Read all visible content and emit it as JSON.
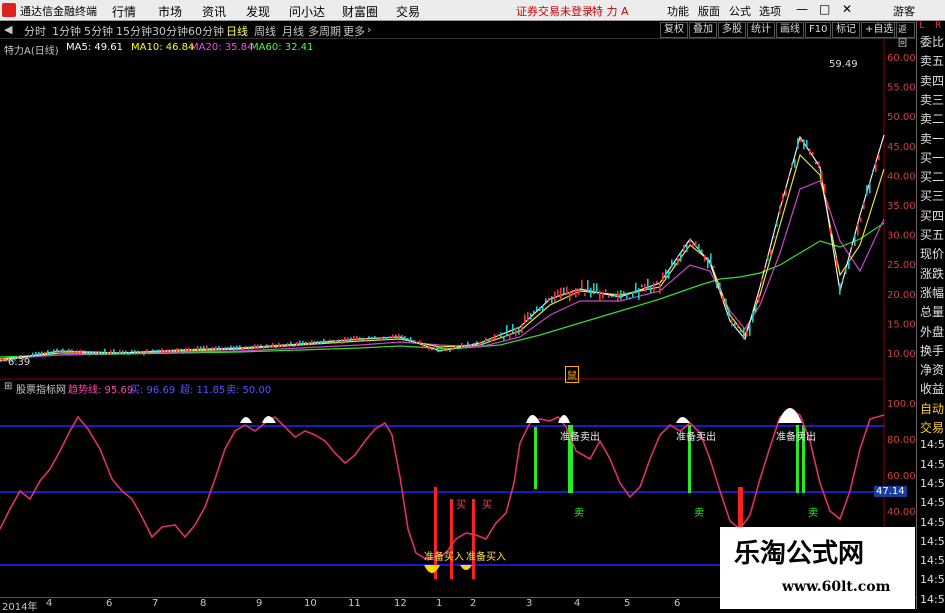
{
  "topbar": {
    "app_title": "通达信金融终端",
    "menu": [
      "行情",
      "市场",
      "资讯",
      "发现",
      "问小达",
      "财富圈",
      "交易"
    ],
    "notice": "证券交易未登录",
    "stock_name": "特 力 A",
    "right_menu": [
      "功能",
      "版面",
      "公式",
      "选项"
    ],
    "guest": "游客"
  },
  "periods": {
    "items": [
      "分时",
      "1分钟",
      "5分钟",
      "15分钟",
      "30分钟",
      "60分钟",
      "日线",
      "周线",
      "月线",
      "多周期",
      "更多"
    ],
    "active_index": 6
  },
  "tools": [
    "复权",
    "叠加",
    "多股",
    "统计",
    "画线",
    "F10",
    "标记",
    "+自选",
    "返回"
  ],
  "main_chart": {
    "title": "特力A(日线)",
    "ma": [
      {
        "label": "MA5: 49.61",
        "color": "#ffffff"
      },
      {
        "label": "MA10: 46.84",
        "color": "#ffff00"
      },
      {
        "label": "MA20: 35.84",
        "color": "#ff44ff"
      },
      {
        "label": "MA60: 32.41",
        "color": "#44ff44"
      }
    ],
    "y_labels": [
      "60.00",
      "55.00",
      "50.00",
      "45.00",
      "40.00",
      "35.00",
      "30.00",
      "25.00",
      "20.00",
      "15.00",
      "10.00"
    ],
    "high_label": "59.49",
    "low_label": "6.39",
    "marker": "鼠"
  },
  "indicator": {
    "name": "股票指标网",
    "legend": [
      {
        "label": "趋势线: 95.69",
        "color": "#ff44aa"
      },
      {
        "label": "买: 96.69",
        "color": "#5555ff"
      },
      {
        "label": "超: 11.85",
        "color": "#5555ff"
      },
      {
        "label": "卖: 50.00",
        "color": "#5555ff"
      }
    ],
    "y_labels": [
      "100.00",
      "80.00",
      "60.00",
      "40.00"
    ],
    "level_label": "47.14",
    "sell_labels": [
      "准备卖出",
      "准备卖出",
      "准备卖出"
    ],
    "buy_labels": [
      "准备买入",
      "准备买入"
    ],
    "buy_marks": [
      "买",
      "买"
    ],
    "sell_marks": [
      "卖",
      "卖",
      "卖"
    ]
  },
  "sidepanel": [
    "委比",
    "卖五",
    "卖四",
    "卖三",
    "卖二",
    "卖一",
    "买一",
    "买二",
    "买三",
    "买四",
    "买五",
    "现价",
    "涨跌",
    "涨幅",
    "总量",
    "外盘",
    "换手",
    "净资",
    "收益",
    "自动",
    "交易",
    "14:5",
    "14:5",
    "14:5",
    "14:5",
    "14:5",
    "14:5",
    "14:5",
    "14:5",
    "14:5"
  ],
  "x_axis": [
    "2014年",
    "4",
    "6",
    "7",
    "8",
    "9",
    "10",
    "11",
    "12",
    "1",
    "2",
    "3",
    "4",
    "5",
    "6"
  ],
  "watermark": {
    "title": "乐淘公式网",
    "url": "www.60lt.com"
  },
  "colors": {
    "up": "#ff3030",
    "down": "#20c8c8",
    "trend": "#e0306a",
    "buy": "#ff2020",
    "sell": "#22ee22"
  }
}
